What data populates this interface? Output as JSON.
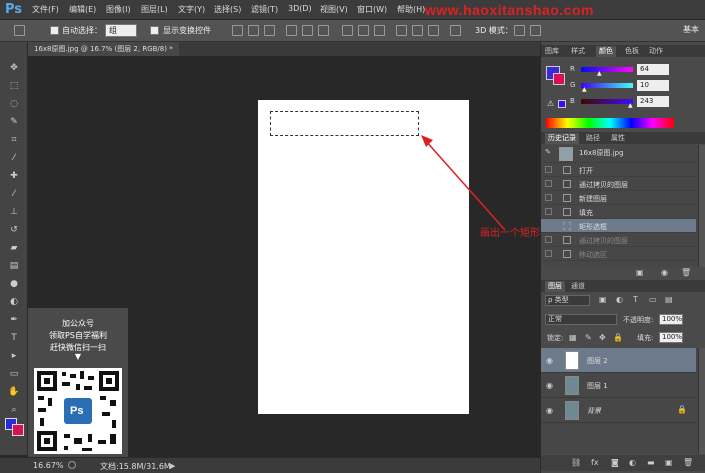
{
  "app": {
    "logo": "Ps"
  },
  "menu": [
    "文件(F)",
    "编辑(E)",
    "图像(I)",
    "图层(L)",
    "文字(Y)",
    "选择(S)",
    "滤镜(T)",
    "3D(D)",
    "视图(V)",
    "窗口(W)",
    "帮助(H)"
  ],
  "watermark": "www.haoxitanshao.com",
  "options": {
    "auto_select_label": "自动选择：",
    "group_value": "组",
    "show_transform_label": "显示变换控件",
    "mode_3d": "3D 模式：",
    "workspace": "基本"
  },
  "document": {
    "tab_title": "16x8原图.jpg @ 16.7% (图层 2, RGB/8) *"
  },
  "annotation": {
    "text": "画出一个矩形"
  },
  "promo": {
    "line1": "加公众号",
    "line2": "领取PS自学福利",
    "line3": "赶快微信扫一扫",
    "arrow": "▼",
    "qr_badge": "Ps"
  },
  "status": {
    "zoom": "16.67%",
    "doc_size": "文档:15.8M/31.6M"
  },
  "panels": {
    "top_tabs": [
      "图库",
      "样式",
      "颜色",
      "色板",
      "动作"
    ],
    "active_top_tab": "颜色",
    "color": {
      "r_label": "R",
      "r_value": "64",
      "g_label": "G",
      "g_value": "10",
      "b_label": "B",
      "b_value": "243",
      "fg_color": "#400af3",
      "bg_color": "#d8105a"
    },
    "history_tabs": [
      "历史记录",
      "路径",
      "属性"
    ],
    "history_snapshot": "16x8原图.jpg",
    "history_items": [
      "打开",
      "通过拷贝的图层",
      "新建图层",
      "填充",
      "矩形选框",
      "通过拷贝的图层",
      "移动选区"
    ],
    "history_selected_index": 4,
    "layers_tabs": [
      "图层",
      "通道"
    ],
    "layers": {
      "filter_kind": "ρ 类型",
      "blend_mode": "正常",
      "opacity_label": "不透明度:",
      "opacity_value": "100%",
      "lock_label": "锁定:",
      "fill_label": "填充:",
      "fill_value": "100%",
      "items": [
        "图层 2",
        "图层 1",
        "背景"
      ]
    }
  },
  "colors": {
    "accent_red": "#e02020",
    "selection": "#6d7a8c"
  }
}
